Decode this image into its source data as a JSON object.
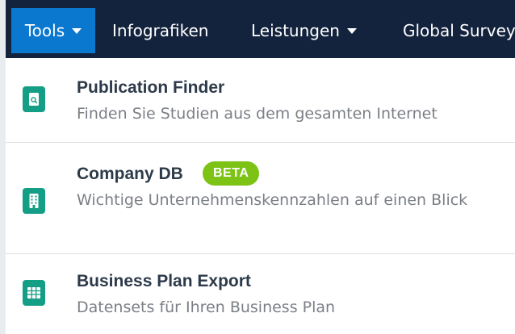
{
  "nav": {
    "tools_label": "Tools",
    "infografiken_label": "Infografiken",
    "leistungen_label": "Leistungen",
    "global_label": "Global Survey"
  },
  "menu": {
    "items": [
      {
        "title": "Publication Finder",
        "description": "Finden Sie Studien aus dem gesamten Internet",
        "icon": "document-search-icon"
      },
      {
        "title": "Company DB",
        "badge": "BETA",
        "description": "Wichtige Unternehmenskennzahlen auf einen Blick",
        "icon": "building-icon"
      },
      {
        "title": "Business Plan Export",
        "description": "Datensets für Ihren Business Plan",
        "icon": "table-icon"
      }
    ]
  },
  "colors": {
    "navbar": "#13233d",
    "active_tab": "#0b78d0",
    "icon_bg": "#139e85",
    "badge": "#7cc316"
  }
}
